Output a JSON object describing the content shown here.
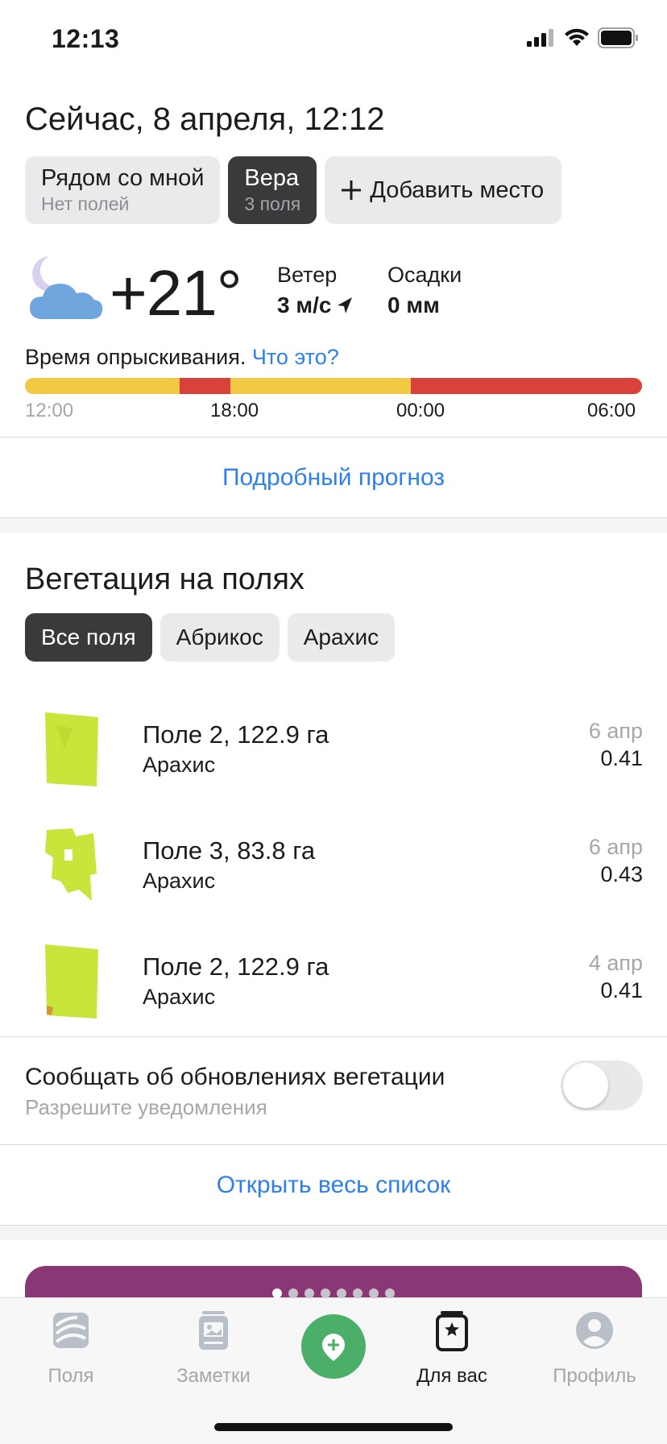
{
  "status_bar": {
    "time": "12:13"
  },
  "header": {
    "title": "Сейчас, 8 апреля, 12:12"
  },
  "places": [
    {
      "name": "Рядом со мной",
      "sub": "Нет полей",
      "active": false
    },
    {
      "name": "Вера",
      "sub": "3 поля",
      "active": true
    }
  ],
  "add_place_label": "Добавить место",
  "weather": {
    "temperature": "+21°",
    "icon": "moon-cloud-icon",
    "wind_label": "Ветер",
    "wind_value": "3 м/с",
    "precip_label": "Осадки",
    "precip_value": "0 мм"
  },
  "spraying": {
    "label": "Время опрыскивания.",
    "link": "Что это?",
    "ticks": [
      "12:00",
      "18:00",
      "00:00",
      "06:00"
    ],
    "segments": [
      {
        "color": "#f3c843",
        "fraction": 0.25
      },
      {
        "color": "#d9423a",
        "fraction": 0.083
      },
      {
        "color": "#f3c843",
        "fraction": 0.292
      },
      {
        "color": "#d9423a",
        "fraction": 0.375
      }
    ]
  },
  "forecast_link": "Подробный прогноз",
  "vegetation": {
    "title": "Вегетация на полях",
    "filters": [
      {
        "label": "Все поля",
        "active": true
      },
      {
        "label": "Абрикос",
        "active": false
      },
      {
        "label": "Арахис",
        "active": false
      }
    ],
    "fields": [
      {
        "name": "Поле 2, 122.9 га",
        "crop": "Арахис",
        "date": "6 апр",
        "value": "0.41"
      },
      {
        "name": "Поле 3, 83.8 га",
        "crop": "Арахис",
        "date": "6 апр",
        "value": "0.43"
      },
      {
        "name": "Поле 2, 122.9 га",
        "crop": "Арахис",
        "date": "4 апр",
        "value": "0.41"
      }
    ]
  },
  "notify": {
    "title": "Сообщать об обновлениях вегетации",
    "sub": "Разрешите уведомления",
    "enabled": false
  },
  "open_list_link": "Открыть весь список",
  "promo": {
    "color": "#8a3776",
    "pages": 8,
    "current_page": 1
  },
  "tabbar": {
    "tabs": [
      {
        "label": "Поля",
        "icon": "fields-icon",
        "active": false
      },
      {
        "label": "Заметки",
        "icon": "notes-icon",
        "active": false
      },
      {
        "label": "Для вас",
        "icon": "for-you-icon",
        "active": true
      },
      {
        "label": "Профиль",
        "icon": "profile-icon",
        "active": false
      }
    ],
    "fab_icon": "add-note-icon"
  },
  "colors": {
    "accent": "#2f80ed",
    "fab": "#4caf69",
    "chip_active": "#3a3a3c",
    "field_green": "#c8e53c"
  }
}
